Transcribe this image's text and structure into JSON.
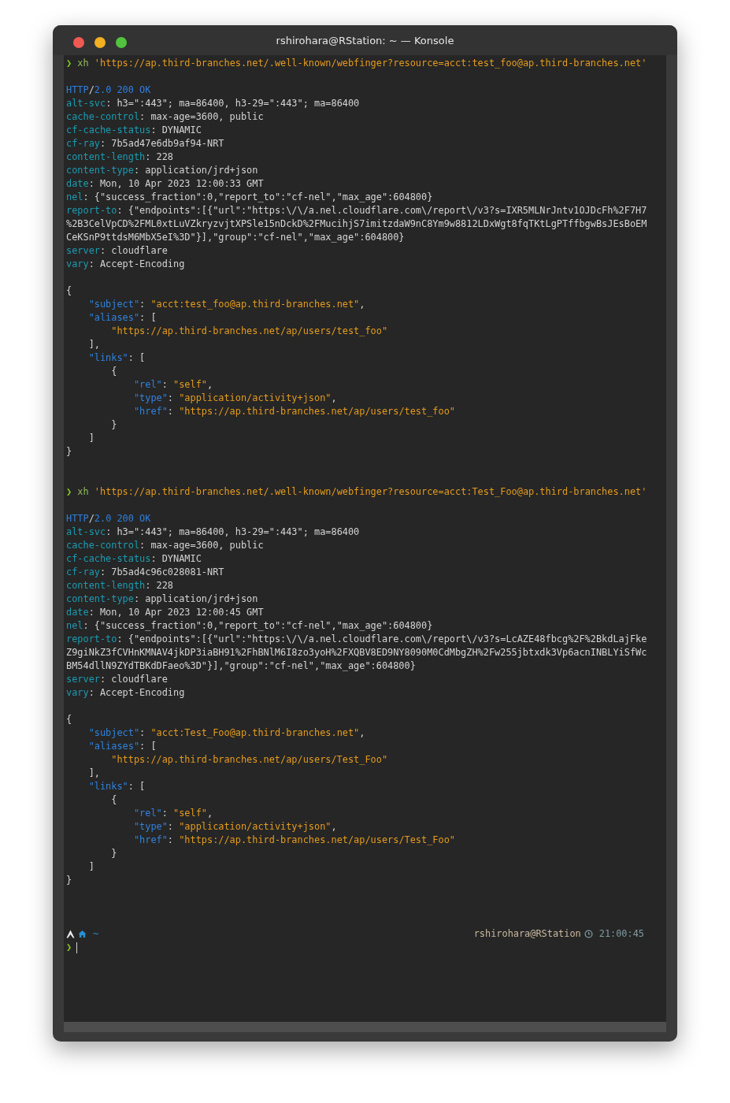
{
  "window": {
    "title": "rshirohara@RStation: ~ — Konsole"
  },
  "lines": [
    {
      "kind": "command",
      "prompt": "❯",
      "program": "xh",
      "argument": "'https://ap.third-branches.net/.well-known/webfinger?resource=acct:test_foo@ap.third-branches.net'"
    },
    {
      "kind": "blank"
    },
    {
      "kind": "output",
      "segments": [
        {
          "kind": "blue",
          "text": "HTTP"
        },
        {
          "kind": "plain",
          "text": "/"
        },
        {
          "kind": "blue",
          "text": "2.0 200 OK"
        }
      ]
    },
    {
      "kind": "output",
      "segments": [
        {
          "kind": "key",
          "text": "alt-svc"
        },
        {
          "kind": "plain",
          "text": ": h3=\":443\"; ma=86400, h3-29=\":443\"; ma=86400"
        }
      ]
    },
    {
      "kind": "output",
      "segments": [
        {
          "kind": "key",
          "text": "cache-control"
        },
        {
          "kind": "plain",
          "text": ": max-age=3600, public"
        }
      ]
    },
    {
      "kind": "output",
      "segments": [
        {
          "kind": "key",
          "text": "cf-cache-status"
        },
        {
          "kind": "plain",
          "text": ": DYNAMIC"
        }
      ]
    },
    {
      "kind": "output",
      "segments": [
        {
          "kind": "key",
          "text": "cf-ray"
        },
        {
          "kind": "plain",
          "text": ": 7b5ad47e6db9af94-NRT"
        }
      ]
    },
    {
      "kind": "output",
      "segments": [
        {
          "kind": "key",
          "text": "content-length"
        },
        {
          "kind": "plain",
          "text": ": 228"
        }
      ]
    },
    {
      "kind": "output",
      "segments": [
        {
          "kind": "key",
          "text": "content-type"
        },
        {
          "kind": "plain",
          "text": ": application/jrd+json"
        }
      ]
    },
    {
      "kind": "output",
      "segments": [
        {
          "kind": "key",
          "text": "date"
        },
        {
          "kind": "plain",
          "text": ": Mon, 10 Apr 2023 12:00:33 GMT"
        }
      ]
    },
    {
      "kind": "output",
      "segments": [
        {
          "kind": "key",
          "text": "nel"
        },
        {
          "kind": "plain",
          "text": ": {\"success_fraction\":0,\"report_to\":\"cf-nel\",\"max_age\":604800}"
        }
      ]
    },
    {
      "kind": "output",
      "segments": [
        {
          "kind": "key",
          "text": "report-to"
        },
        {
          "kind": "plain",
          "text": ": {\"endpoints\":[{\"url\":\"https:\\/\\/a.nel.cloudflare.com\\/report\\/v3?s=IXR5MLNrJntv1OJDcFh%2F7H7"
        }
      ]
    },
    {
      "kind": "output",
      "segments": [
        {
          "kind": "plain",
          "text": "%2B3CelVpCD%2FML0xtLuVZkryzvjtXPSle15nDckD%2FMucihjS7imitzdaW9nC8Ym9w8812LDxWgt8fqTKtLgPTffbgwBsJEsBoEM"
        }
      ]
    },
    {
      "kind": "output",
      "segments": [
        {
          "kind": "plain",
          "text": "CeKSnP9ttdsM6MbX5eI%3D\"}],\"group\":\"cf-nel\",\"max_age\":604800}"
        }
      ]
    },
    {
      "kind": "output",
      "segments": [
        {
          "kind": "key",
          "text": "server"
        },
        {
          "kind": "plain",
          "text": ": cloudflare"
        }
      ]
    },
    {
      "kind": "output",
      "segments": [
        {
          "kind": "key",
          "text": "vary"
        },
        {
          "kind": "plain",
          "text": ": Accept-Encoding"
        }
      ]
    },
    {
      "kind": "blank"
    },
    {
      "kind": "output",
      "segments": [
        {
          "kind": "plain",
          "text": "{"
        }
      ]
    },
    {
      "kind": "output",
      "segments": [
        {
          "kind": "jkey",
          "text": "    \"subject\""
        },
        {
          "kind": "plain",
          "text": ": "
        },
        {
          "kind": "str",
          "text": "\"acct:test_foo@ap.third-branches.net\""
        },
        {
          "kind": "plain",
          "text": ","
        }
      ]
    },
    {
      "kind": "output",
      "segments": [
        {
          "kind": "jkey",
          "text": "    \"aliases\""
        },
        {
          "kind": "plain",
          "text": ": ["
        }
      ]
    },
    {
      "kind": "output",
      "segments": [
        {
          "kind": "str",
          "text": "        \"https://ap.third-branches.net/ap/users/test_foo\""
        }
      ]
    },
    {
      "kind": "output",
      "segments": [
        {
          "kind": "plain",
          "text": "    ],"
        }
      ]
    },
    {
      "kind": "output",
      "segments": [
        {
          "kind": "jkey",
          "text": "    \"links\""
        },
        {
          "kind": "plain",
          "text": ": ["
        }
      ]
    },
    {
      "kind": "output",
      "segments": [
        {
          "kind": "plain",
          "text": "        {"
        }
      ]
    },
    {
      "kind": "output",
      "segments": [
        {
          "kind": "jkey",
          "text": "            \"rel\""
        },
        {
          "kind": "plain",
          "text": ": "
        },
        {
          "kind": "str",
          "text": "\"self\""
        },
        {
          "kind": "plain",
          "text": ","
        }
      ]
    },
    {
      "kind": "output",
      "segments": [
        {
          "kind": "jkey",
          "text": "            \"type\""
        },
        {
          "kind": "plain",
          "text": ": "
        },
        {
          "kind": "str",
          "text": "\"application/activity+json\""
        },
        {
          "kind": "plain",
          "text": ","
        }
      ]
    },
    {
      "kind": "output",
      "segments": [
        {
          "kind": "jkey",
          "text": "            \"href\""
        },
        {
          "kind": "plain",
          "text": ": "
        },
        {
          "kind": "str",
          "text": "\"https://ap.third-branches.net/ap/users/test_foo\""
        }
      ]
    },
    {
      "kind": "output",
      "segments": [
        {
          "kind": "plain",
          "text": "        }"
        }
      ]
    },
    {
      "kind": "output",
      "segments": [
        {
          "kind": "plain",
          "text": "    ]"
        }
      ]
    },
    {
      "kind": "output",
      "segments": [
        {
          "kind": "plain",
          "text": "}"
        }
      ]
    },
    {
      "kind": "blank"
    },
    {
      "kind": "blank"
    },
    {
      "kind": "command",
      "prompt": "❯",
      "program": "xh",
      "argument": "'https://ap.third-branches.net/.well-known/webfinger?resource=acct:Test_Foo@ap.third-branches.net'"
    },
    {
      "kind": "blank"
    },
    {
      "kind": "output",
      "segments": [
        {
          "kind": "blue",
          "text": "HTTP"
        },
        {
          "kind": "plain",
          "text": "/"
        },
        {
          "kind": "blue",
          "text": "2.0 200 OK"
        }
      ]
    },
    {
      "kind": "output",
      "segments": [
        {
          "kind": "key",
          "text": "alt-svc"
        },
        {
          "kind": "plain",
          "text": ": h3=\":443\"; ma=86400, h3-29=\":443\"; ma=86400"
        }
      ]
    },
    {
      "kind": "output",
      "segments": [
        {
          "kind": "key",
          "text": "cache-control"
        },
        {
          "kind": "plain",
          "text": ": max-age=3600, public"
        }
      ]
    },
    {
      "kind": "output",
      "segments": [
        {
          "kind": "key",
          "text": "cf-cache-status"
        },
        {
          "kind": "plain",
          "text": ": DYNAMIC"
        }
      ]
    },
    {
      "kind": "output",
      "segments": [
        {
          "kind": "key",
          "text": "cf-ray"
        },
        {
          "kind": "plain",
          "text": ": 7b5ad4c96c028081-NRT"
        }
      ]
    },
    {
      "kind": "output",
      "segments": [
        {
          "kind": "key",
          "text": "content-length"
        },
        {
          "kind": "plain",
          "text": ": 228"
        }
      ]
    },
    {
      "kind": "output",
      "segments": [
        {
          "kind": "key",
          "text": "content-type"
        },
        {
          "kind": "plain",
          "text": ": application/jrd+json"
        }
      ]
    },
    {
      "kind": "output",
      "segments": [
        {
          "kind": "key",
          "text": "date"
        },
        {
          "kind": "plain",
          "text": ": Mon, 10 Apr 2023 12:00:45 GMT"
        }
      ]
    },
    {
      "kind": "output",
      "segments": [
        {
          "kind": "key",
          "text": "nel"
        },
        {
          "kind": "plain",
          "text": ": {\"success_fraction\":0,\"report_to\":\"cf-nel\",\"max_age\":604800}"
        }
      ]
    },
    {
      "kind": "output",
      "segments": [
        {
          "kind": "key",
          "text": "report-to"
        },
        {
          "kind": "plain",
          "text": ": {\"endpoints\":[{\"url\":\"https:\\/\\/a.nel.cloudflare.com\\/report\\/v3?s=LcAZE48fbcg%2F%2BkdLajFke"
        }
      ]
    },
    {
      "kind": "output",
      "segments": [
        {
          "kind": "plain",
          "text": "Z9giNkZ3fCVHnKMNAV4jkDP3iaBH91%2FhBNlM6I8zo3yoH%2FXQBV8ED9NY8090M0CdMbgZH%2Fw255jbtxdk3Vp6acnINBLYiSfWc"
        }
      ]
    },
    {
      "kind": "output",
      "segments": [
        {
          "kind": "plain",
          "text": "BM54dllN9ZYdTBKdDFaeo%3D\"}],\"group\":\"cf-nel\",\"max_age\":604800}"
        }
      ]
    },
    {
      "kind": "output",
      "segments": [
        {
          "kind": "key",
          "text": "server"
        },
        {
          "kind": "plain",
          "text": ": cloudflare"
        }
      ]
    },
    {
      "kind": "output",
      "segments": [
        {
          "kind": "key",
          "text": "vary"
        },
        {
          "kind": "plain",
          "text": ": Accept-Encoding"
        }
      ]
    },
    {
      "kind": "blank"
    },
    {
      "kind": "output",
      "segments": [
        {
          "kind": "plain",
          "text": "{"
        }
      ]
    },
    {
      "kind": "output",
      "segments": [
        {
          "kind": "jkey",
          "text": "    \"subject\""
        },
        {
          "kind": "plain",
          "text": ": "
        },
        {
          "kind": "str",
          "text": "\"acct:Test_Foo@ap.third-branches.net\""
        },
        {
          "kind": "plain",
          "text": ","
        }
      ]
    },
    {
      "kind": "output",
      "segments": [
        {
          "kind": "jkey",
          "text": "    \"aliases\""
        },
        {
          "kind": "plain",
          "text": ": ["
        }
      ]
    },
    {
      "kind": "output",
      "segments": [
        {
          "kind": "str",
          "text": "        \"https://ap.third-branches.net/ap/users/Test_Foo\""
        }
      ]
    },
    {
      "kind": "output",
      "segments": [
        {
          "kind": "plain",
          "text": "    ],"
        }
      ]
    },
    {
      "kind": "output",
      "segments": [
        {
          "kind": "jkey",
          "text": "    \"links\""
        },
        {
          "kind": "plain",
          "text": ": ["
        }
      ]
    },
    {
      "kind": "output",
      "segments": [
        {
          "kind": "plain",
          "text": "        {"
        }
      ]
    },
    {
      "kind": "output",
      "segments": [
        {
          "kind": "jkey",
          "text": "            \"rel\""
        },
        {
          "kind": "plain",
          "text": ": "
        },
        {
          "kind": "str",
          "text": "\"self\""
        },
        {
          "kind": "plain",
          "text": ","
        }
      ]
    },
    {
      "kind": "output",
      "segments": [
        {
          "kind": "jkey",
          "text": "            \"type\""
        },
        {
          "kind": "plain",
          "text": ": "
        },
        {
          "kind": "str",
          "text": "\"application/activity+json\""
        },
        {
          "kind": "plain",
          "text": ","
        }
      ]
    },
    {
      "kind": "output",
      "segments": [
        {
          "kind": "jkey",
          "text": "            \"href\""
        },
        {
          "kind": "plain",
          "text": ": "
        },
        {
          "kind": "str",
          "text": "\"https://ap.third-branches.net/ap/users/Test_Foo\""
        }
      ]
    },
    {
      "kind": "output",
      "segments": [
        {
          "kind": "plain",
          "text": "        }"
        }
      ]
    },
    {
      "kind": "output",
      "segments": [
        {
          "kind": "plain",
          "text": "    ]"
        }
      ]
    },
    {
      "kind": "output",
      "segments": [
        {
          "kind": "plain",
          "text": "}"
        }
      ]
    },
    {
      "kind": "blank"
    },
    {
      "kind": "blank"
    },
    {
      "kind": "blank"
    }
  ],
  "prompt_status": {
    "path": "~",
    "host": "rshirohara@RStation",
    "time": "21:00:45"
  },
  "input_prompt": {
    "symbol": "❯"
  }
}
